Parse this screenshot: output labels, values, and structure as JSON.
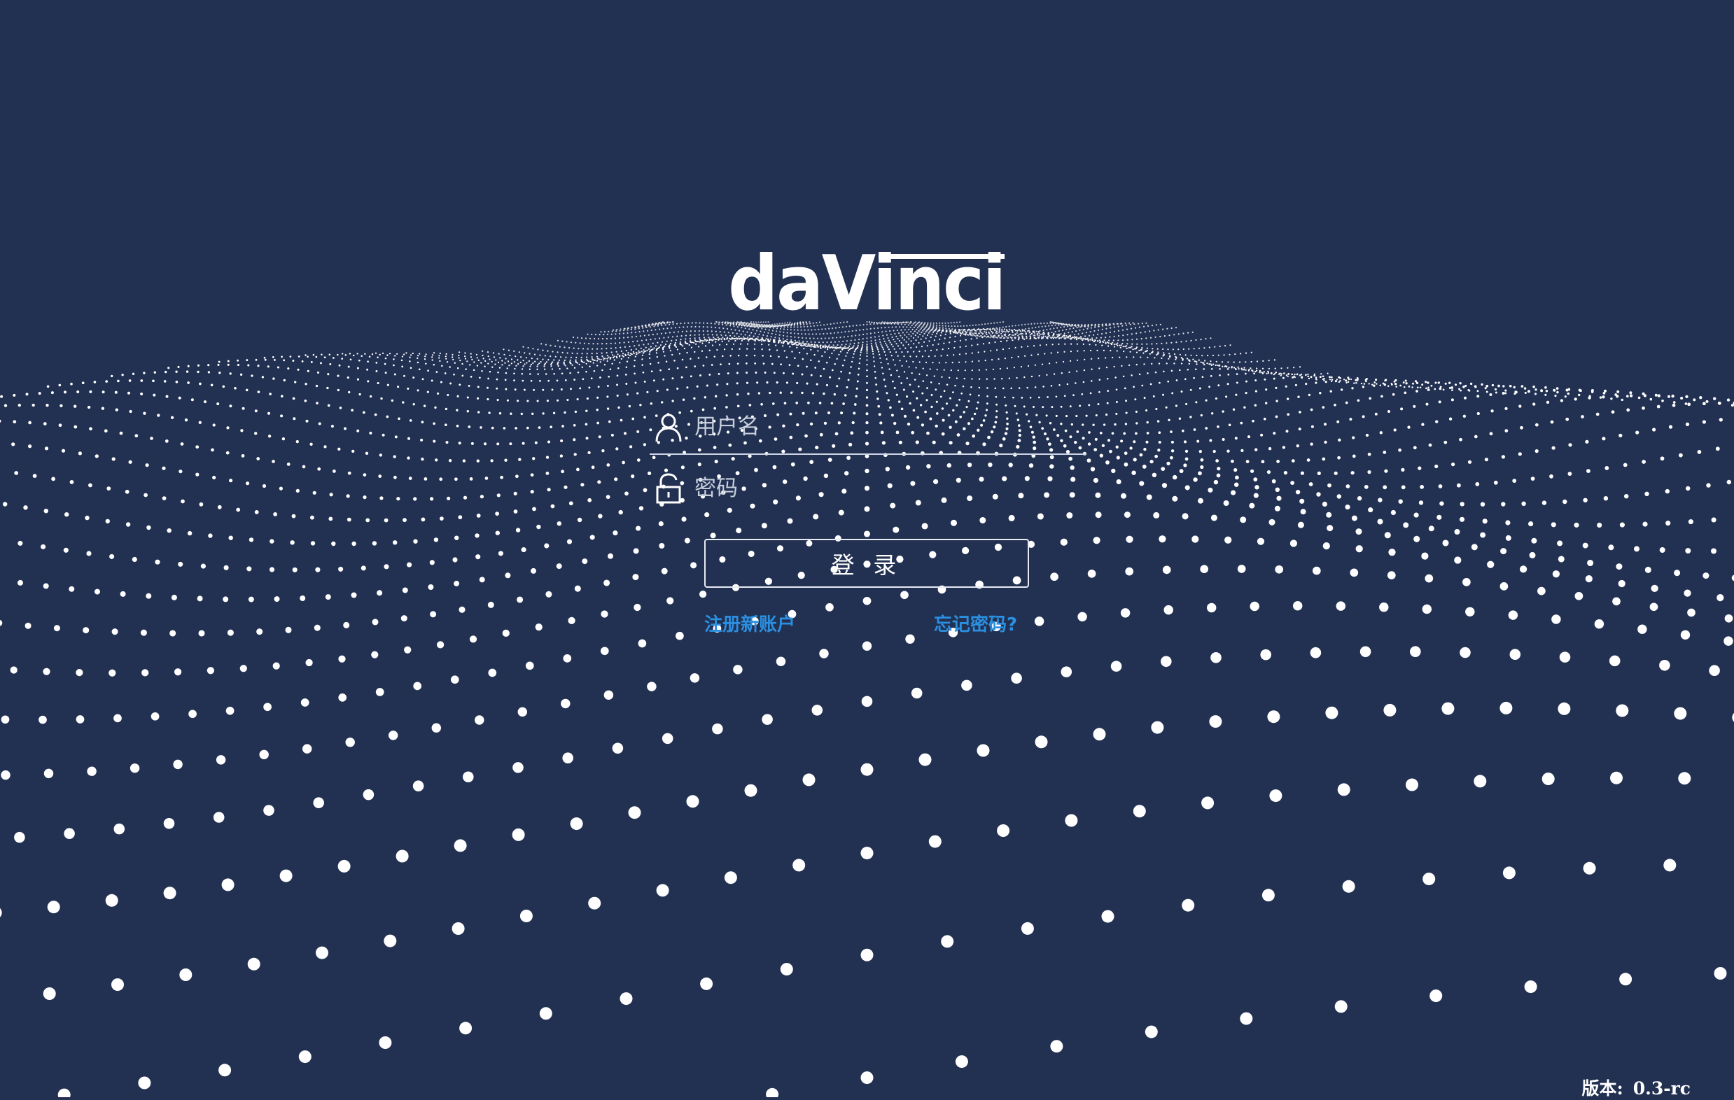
{
  "brand": {
    "logo_text": "daVinci"
  },
  "login_form": {
    "username_placeholder": "用户名",
    "password_placeholder": "密码",
    "login_label": "登 录",
    "register_link": "注册新账户",
    "forgot_link": "忘记密码?"
  },
  "footer": {
    "version_label": "版本:",
    "version_value": "0.3-rc"
  },
  "colors": {
    "background": "#223052",
    "link": "#2b8fe0",
    "text": "#ffffff",
    "particle": "#ffffff"
  },
  "icons": {
    "username": "user-icon",
    "password": "unlock-icon"
  }
}
